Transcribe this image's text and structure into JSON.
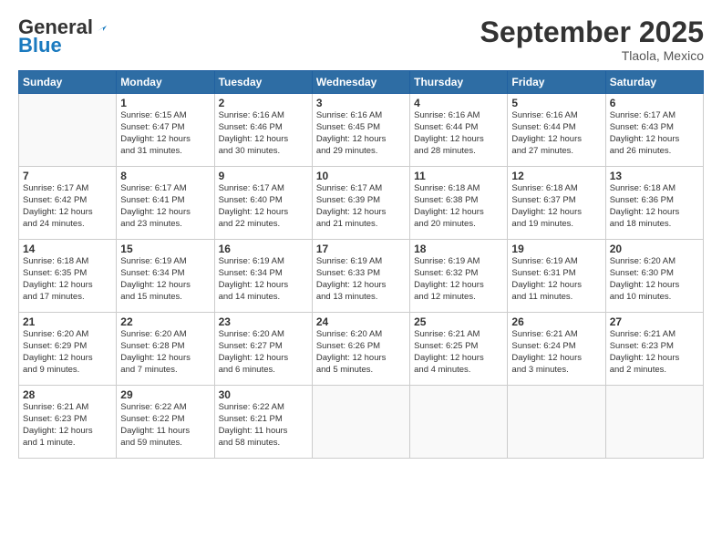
{
  "header": {
    "logo_general": "General",
    "logo_blue": "Blue",
    "month_title": "September 2025",
    "location": "Tlaola, Mexico"
  },
  "weekdays": [
    "Sunday",
    "Monday",
    "Tuesday",
    "Wednesday",
    "Thursday",
    "Friday",
    "Saturday"
  ],
  "weeks": [
    [
      {
        "day": "",
        "info": ""
      },
      {
        "day": "1",
        "info": "Sunrise: 6:15 AM\nSunset: 6:47 PM\nDaylight: 12 hours\nand 31 minutes."
      },
      {
        "day": "2",
        "info": "Sunrise: 6:16 AM\nSunset: 6:46 PM\nDaylight: 12 hours\nand 30 minutes."
      },
      {
        "day": "3",
        "info": "Sunrise: 6:16 AM\nSunset: 6:45 PM\nDaylight: 12 hours\nand 29 minutes."
      },
      {
        "day": "4",
        "info": "Sunrise: 6:16 AM\nSunset: 6:44 PM\nDaylight: 12 hours\nand 28 minutes."
      },
      {
        "day": "5",
        "info": "Sunrise: 6:16 AM\nSunset: 6:44 PM\nDaylight: 12 hours\nand 27 minutes."
      },
      {
        "day": "6",
        "info": "Sunrise: 6:17 AM\nSunset: 6:43 PM\nDaylight: 12 hours\nand 26 minutes."
      }
    ],
    [
      {
        "day": "7",
        "info": "Sunrise: 6:17 AM\nSunset: 6:42 PM\nDaylight: 12 hours\nand 24 minutes."
      },
      {
        "day": "8",
        "info": "Sunrise: 6:17 AM\nSunset: 6:41 PM\nDaylight: 12 hours\nand 23 minutes."
      },
      {
        "day": "9",
        "info": "Sunrise: 6:17 AM\nSunset: 6:40 PM\nDaylight: 12 hours\nand 22 minutes."
      },
      {
        "day": "10",
        "info": "Sunrise: 6:17 AM\nSunset: 6:39 PM\nDaylight: 12 hours\nand 21 minutes."
      },
      {
        "day": "11",
        "info": "Sunrise: 6:18 AM\nSunset: 6:38 PM\nDaylight: 12 hours\nand 20 minutes."
      },
      {
        "day": "12",
        "info": "Sunrise: 6:18 AM\nSunset: 6:37 PM\nDaylight: 12 hours\nand 19 minutes."
      },
      {
        "day": "13",
        "info": "Sunrise: 6:18 AM\nSunset: 6:36 PM\nDaylight: 12 hours\nand 18 minutes."
      }
    ],
    [
      {
        "day": "14",
        "info": "Sunrise: 6:18 AM\nSunset: 6:35 PM\nDaylight: 12 hours\nand 17 minutes."
      },
      {
        "day": "15",
        "info": "Sunrise: 6:19 AM\nSunset: 6:34 PM\nDaylight: 12 hours\nand 15 minutes."
      },
      {
        "day": "16",
        "info": "Sunrise: 6:19 AM\nSunset: 6:34 PM\nDaylight: 12 hours\nand 14 minutes."
      },
      {
        "day": "17",
        "info": "Sunrise: 6:19 AM\nSunset: 6:33 PM\nDaylight: 12 hours\nand 13 minutes."
      },
      {
        "day": "18",
        "info": "Sunrise: 6:19 AM\nSunset: 6:32 PM\nDaylight: 12 hours\nand 12 minutes."
      },
      {
        "day": "19",
        "info": "Sunrise: 6:19 AM\nSunset: 6:31 PM\nDaylight: 12 hours\nand 11 minutes."
      },
      {
        "day": "20",
        "info": "Sunrise: 6:20 AM\nSunset: 6:30 PM\nDaylight: 12 hours\nand 10 minutes."
      }
    ],
    [
      {
        "day": "21",
        "info": "Sunrise: 6:20 AM\nSunset: 6:29 PM\nDaylight: 12 hours\nand 9 minutes."
      },
      {
        "day": "22",
        "info": "Sunrise: 6:20 AM\nSunset: 6:28 PM\nDaylight: 12 hours\nand 7 minutes."
      },
      {
        "day": "23",
        "info": "Sunrise: 6:20 AM\nSunset: 6:27 PM\nDaylight: 12 hours\nand 6 minutes."
      },
      {
        "day": "24",
        "info": "Sunrise: 6:20 AM\nSunset: 6:26 PM\nDaylight: 12 hours\nand 5 minutes."
      },
      {
        "day": "25",
        "info": "Sunrise: 6:21 AM\nSunset: 6:25 PM\nDaylight: 12 hours\nand 4 minutes."
      },
      {
        "day": "26",
        "info": "Sunrise: 6:21 AM\nSunset: 6:24 PM\nDaylight: 12 hours\nand 3 minutes."
      },
      {
        "day": "27",
        "info": "Sunrise: 6:21 AM\nSunset: 6:23 PM\nDaylight: 12 hours\nand 2 minutes."
      }
    ],
    [
      {
        "day": "28",
        "info": "Sunrise: 6:21 AM\nSunset: 6:23 PM\nDaylight: 12 hours\nand 1 minute."
      },
      {
        "day": "29",
        "info": "Sunrise: 6:22 AM\nSunset: 6:22 PM\nDaylight: 11 hours\nand 59 minutes."
      },
      {
        "day": "30",
        "info": "Sunrise: 6:22 AM\nSunset: 6:21 PM\nDaylight: 11 hours\nand 58 minutes."
      },
      {
        "day": "",
        "info": ""
      },
      {
        "day": "",
        "info": ""
      },
      {
        "day": "",
        "info": ""
      },
      {
        "day": "",
        "info": ""
      }
    ]
  ]
}
